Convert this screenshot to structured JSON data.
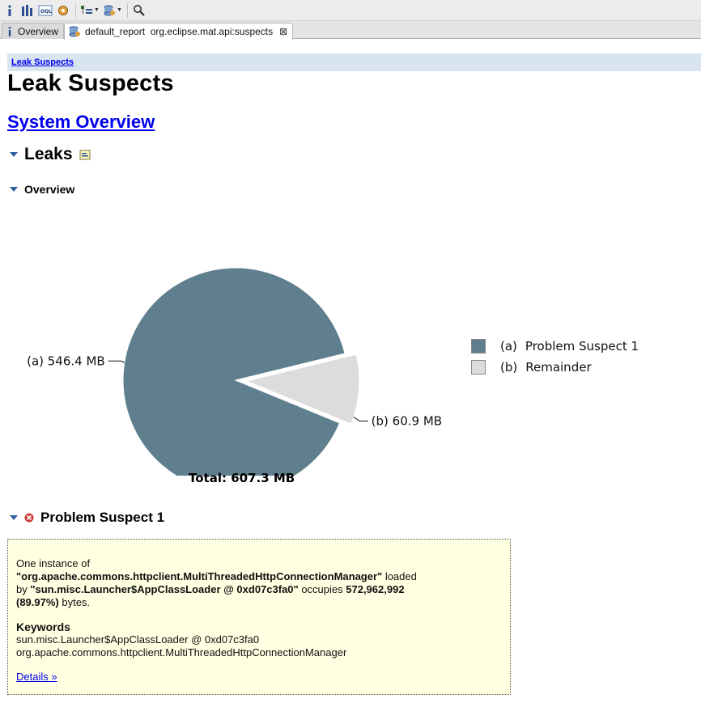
{
  "tabs": [
    {
      "label": "Overview",
      "active": false
    },
    {
      "label": "default_report  org.eclipse.mat.api:suspects",
      "active": true
    }
  ],
  "toolbar": {
    "icons": [
      "info-icon",
      "histogram-icon",
      "oql-icon",
      "gear-icon",
      "dominator-tree-icon",
      "heap-dump-icon",
      "search-icon"
    ]
  },
  "report": {
    "breadcrumb": "Leak Suspects",
    "title": "Leak Suspects",
    "system_overview_link": "System Overview",
    "leaks_heading": "Leaks",
    "overview_heading": "Overview",
    "total_label": "Total: 607.3 MB",
    "problem_heading": "Problem Suspect 1"
  },
  "chart_data": {
    "type": "pie",
    "slices": [
      {
        "key": "(a)",
        "label": "546.4 MB",
        "value": 546.4,
        "legend": "Problem Suspect 1",
        "color": "#607f8e"
      },
      {
        "key": "(b)",
        "label": "60.9 MB",
        "value": 60.9,
        "legend": "Remainder",
        "color": "#dcdcdc"
      }
    ],
    "total": 607.3,
    "legend_position": "right"
  },
  "suspect": {
    "line1": "One instance of",
    "class_name": "\"org.apache.commons.httpclient.MultiThreadedHttpConnectionManager\"",
    "loaded": " loaded",
    "by": "by ",
    "loader": "\"sun.misc.Launcher$AppClassLoader @ 0xd07c3fa0\"",
    "occupies": " occupies ",
    "bytes_value": "572,962,992",
    "percent": "(89.97%)",
    "bytes_word": " bytes.",
    "keywords_title": "Keywords",
    "keywords": [
      "sun.misc.Launcher$AppClassLoader @ 0xd07c3fa0",
      "org.apache.commons.httpclient.MultiThreadedHttpConnectionManager"
    ],
    "details_link": "Details »"
  }
}
